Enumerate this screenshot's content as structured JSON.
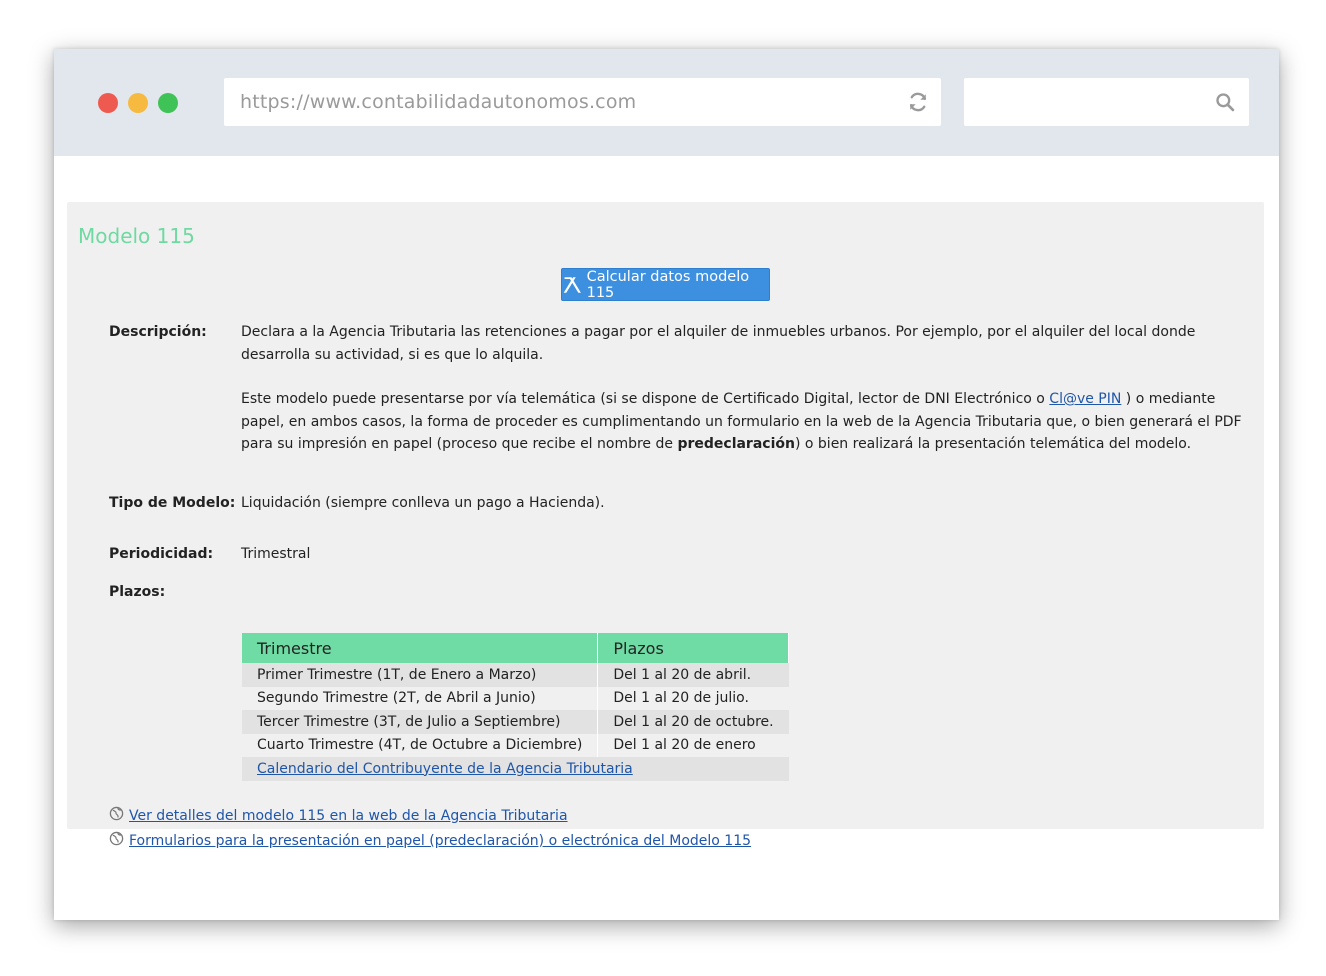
{
  "browser": {
    "url": "https://www.contabilidadautonomos.com",
    "search_placeholder": ""
  },
  "page": {
    "title": "Modelo 115",
    "calc_button_label": "Calcular datos modelo 115",
    "descripcion": {
      "label": "Descripción:",
      "p1": "Declara a la Agencia Tributaria las retenciones a pagar por el alquiler de inmuebles urbanos. Por ejemplo, por el alquiler del local donde desarrolla su actividad, si es que lo alquila.",
      "p2_before": "Este modelo puede presentarse por vía telemática (si se dispone de Certificado Digital, lector de DNI Electrónico o ",
      "p2_link": "Cl@ve PIN",
      "p2_middle": " ) o mediante papel, en ambos casos, la forma de proceder es cumplimentando un formulario en la web de la Agencia Tributaria que, o bien generará el PDF para su impresión en papel (proceso que recibe el nombre de ",
      "p2_bold": "predeclaración",
      "p2_after": ") o bien realizará la presentación telemática del modelo."
    },
    "tipo": {
      "label": "Tipo de Modelo:",
      "value": "Liquidación (siempre conlleva un pago a Hacienda)."
    },
    "periodicidad": {
      "label": "Periodicidad:",
      "value": "Trimestral"
    },
    "plazos": {
      "label": "Plazos:",
      "headers": [
        "Trimestre",
        "Plazos"
      ],
      "rows": [
        [
          "Primer Trimestre (1T, de Enero a Marzo)",
          "Del 1 al 20 de abril."
        ],
        [
          "Segundo Trimestre (2T, de Abril a Junio)",
          "Del 1 al 20 de julio."
        ],
        [
          "Tercer Trimestre (3T, de Julio a Septiembre)",
          "Del 1 al 20 de octubre."
        ],
        [
          "Cuarto Trimestre (4T, de Octubre a Diciembre)",
          "Del 1 al 20 de enero"
        ]
      ],
      "footer_link": "Calendario del Contribuyente de la Agencia Tributaria"
    },
    "links": [
      "Ver detalles del modelo 115 en la web de la Agencia Tributaria ",
      "Formularios para la presentación en papel (predeclaración) o electrónica del Modelo 115 "
    ]
  },
  "colors": {
    "title_green": "#6fd9a2",
    "table_header": "#6edca4",
    "button_blue": "#3d8fe0",
    "link_blue": "#1f56a8",
    "panel_bg": "#f0f0f0",
    "topbar_bg": "#e1e7ec"
  },
  "icons": [
    "reload-icon",
    "search-icon",
    "aeat-logo-icon",
    "globe-icon"
  ]
}
